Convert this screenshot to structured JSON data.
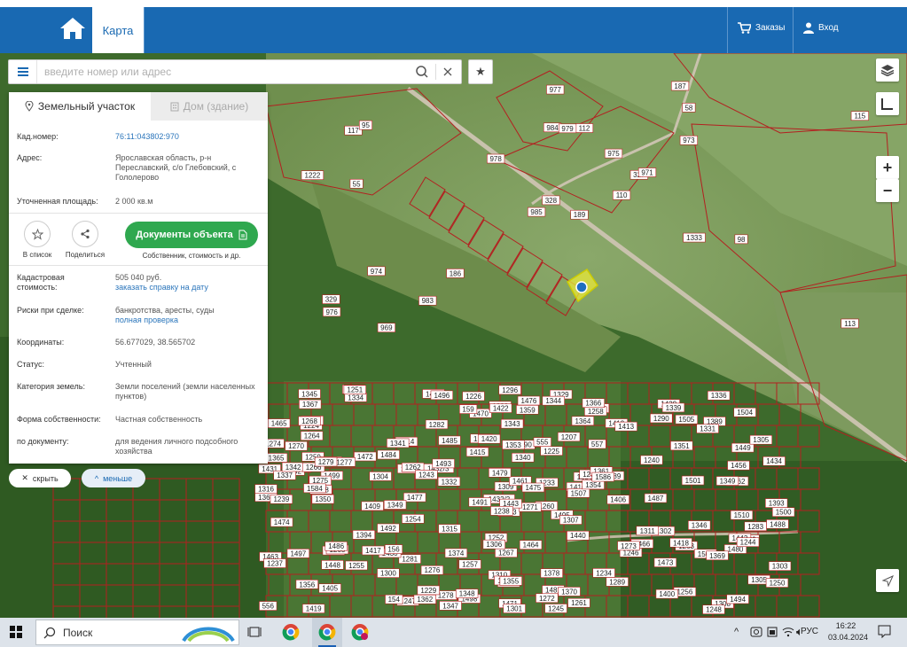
{
  "nav": {
    "tab": "Карта",
    "orders": "Заказы",
    "login": "Вход"
  },
  "search": {
    "placeholder": "введите номер или адрес"
  },
  "panel": {
    "tabs": [
      "Земельный участок",
      "Дом (здание)"
    ],
    "fields": {
      "kad_label": "Кад.номер:",
      "kad_value": "76:11:043802:970",
      "addr_label": "Адрес:",
      "addr_value": "Ярославская область, р-н Переславский, с/о Глебовский, с Гололерово",
      "area_label": "Уточненная площадь:",
      "area_value": "2 000 кв.м",
      "cost_label": "Кадастровая стоимость:",
      "cost_value": "505 040 руб.",
      "cost_link": "заказать справку на дату",
      "risk_label": "Риски при сделке:",
      "risk_value": "банкротства, аресты, суды",
      "risk_link": "полная проверка",
      "coord_label": "Координаты:",
      "coord_value": "56.677029, 38.565702",
      "status_label": "Статус:",
      "status_value": "Учтенный",
      "cat_label": "Категория земель:",
      "cat_value": "Земли поселений (земли населенных пунктов)",
      "own_label": "Форма собственности:",
      "own_value": "Частная собственность",
      "doc_label": "по документу:",
      "doc_value": "для ведения личного подсобного хозяйства"
    },
    "actions": {
      "list": "В список",
      "share": "Поделиться",
      "docs": "Документы объекта",
      "docs_sub": "Собственник, стоимость и др."
    }
  },
  "pills": {
    "hide": "скрыть",
    "less": "меньше"
  },
  "map": {
    "parcels": [
      "189",
      "117",
      "328",
      "329",
      "327",
      "186",
      "187",
      "112",
      "58",
      "110",
      "117",
      "113",
      "55",
      "115",
      "985",
      "973",
      "969",
      "984",
      "975",
      "974",
      "978",
      "976",
      "983",
      "979",
      "971",
      "98",
      "95",
      "977",
      "1222",
      "1333",
      "1434",
      "1432/2",
      "1310",
      "1309",
      "1314",
      "1290",
      "1281",
      "1308",
      "1305",
      "1302",
      "1329",
      "1432/3",
      "1304",
      "1246",
      "1247",
      "1431",
      "1416",
      "1419",
      "1478",
      "1507",
      "1448",
      "1449",
      "1465",
      "1466",
      "1289",
      "1300",
      "1334",
      "1345",
      "1378",
      "1389",
      "1476",
      "1477",
      "1483",
      "1484",
      "1505",
      "1506",
      "1468",
      "1470",
      "1461",
      "1463",
      "1267",
      "1278",
      "1311",
      "1322",
      "1356",
      "1367",
      "1472",
      "1474",
      "1479",
      "1481",
      "1233",
      "1405",
      "1406",
      "1469",
      "1471",
      "1462",
      "1464",
      "1256",
      "1245",
      "1234",
      "1223",
      "1500",
      "1489",
      "1473",
      "1475",
      "1480",
      "1482",
      "1301",
      "1412",
      "1413",
      "1409",
      "1410",
      "1393",
      "1337",
      "1394",
      "1430",
      "1229",
      "1228",
      "1331",
      "1332",
      "1510",
      "1224",
      "1490",
      "1491",
      "1496",
      "1497",
      "1503",
      "1504",
      "1227",
      "1226",
      "1335",
      "1336",
      "1225",
      "1485",
      "1487",
      "1492",
      "1494",
      "1498",
      "1501",
      "1264",
      "1265",
      "1261",
      "1262",
      "1282",
      "1283",
      "1263",
      "1254",
      "1486",
      "1488",
      "1493",
      "1495",
      "1499",
      "1502",
      "1260",
      "1284",
      "1386",
      "1348",
      "1400",
      "1411",
      "1422",
      "1456",
      "1341",
      "1342",
      "1347",
      "1346",
      "1344",
      "1343",
      "1340",
      "1349",
      "1207",
      "1440",
      "1359",
      "1360",
      "1296",
      "1258",
      "1259",
      "1252",
      "1250",
      "1251",
      "1248",
      "1369",
      "1370",
      "1365",
      "1366",
      "1361",
      "1362",
      "1364",
      "1273",
      "1274",
      "1269",
      "1270",
      "1271",
      "1272",
      "1266",
      "1268",
      "1277",
      "1279",
      "1275",
      "1276",
      "1443",
      "1442",
      "1374",
      "1353",
      "1351",
      "1354",
      "1355",
      "1350",
      "1420",
      "1418",
      "1417",
      "1428",
      "1439",
      "1415",
      "1316",
      "1240",
      "1239",
      "1238",
      "1237",
      "1306",
      "1339",
      "1303",
      "1305",
      "1243",
      "1244",
      "1349",
      "1257",
      "1255",
      "1307",
      "1315",
      "1584",
      "159",
      "555",
      "556",
      "557",
      "154",
      "156",
      "1586"
    ]
  },
  "taskbar": {
    "search": "Поиск",
    "lang": "РУС",
    "time": "16:22",
    "date": "03.04.2024"
  }
}
